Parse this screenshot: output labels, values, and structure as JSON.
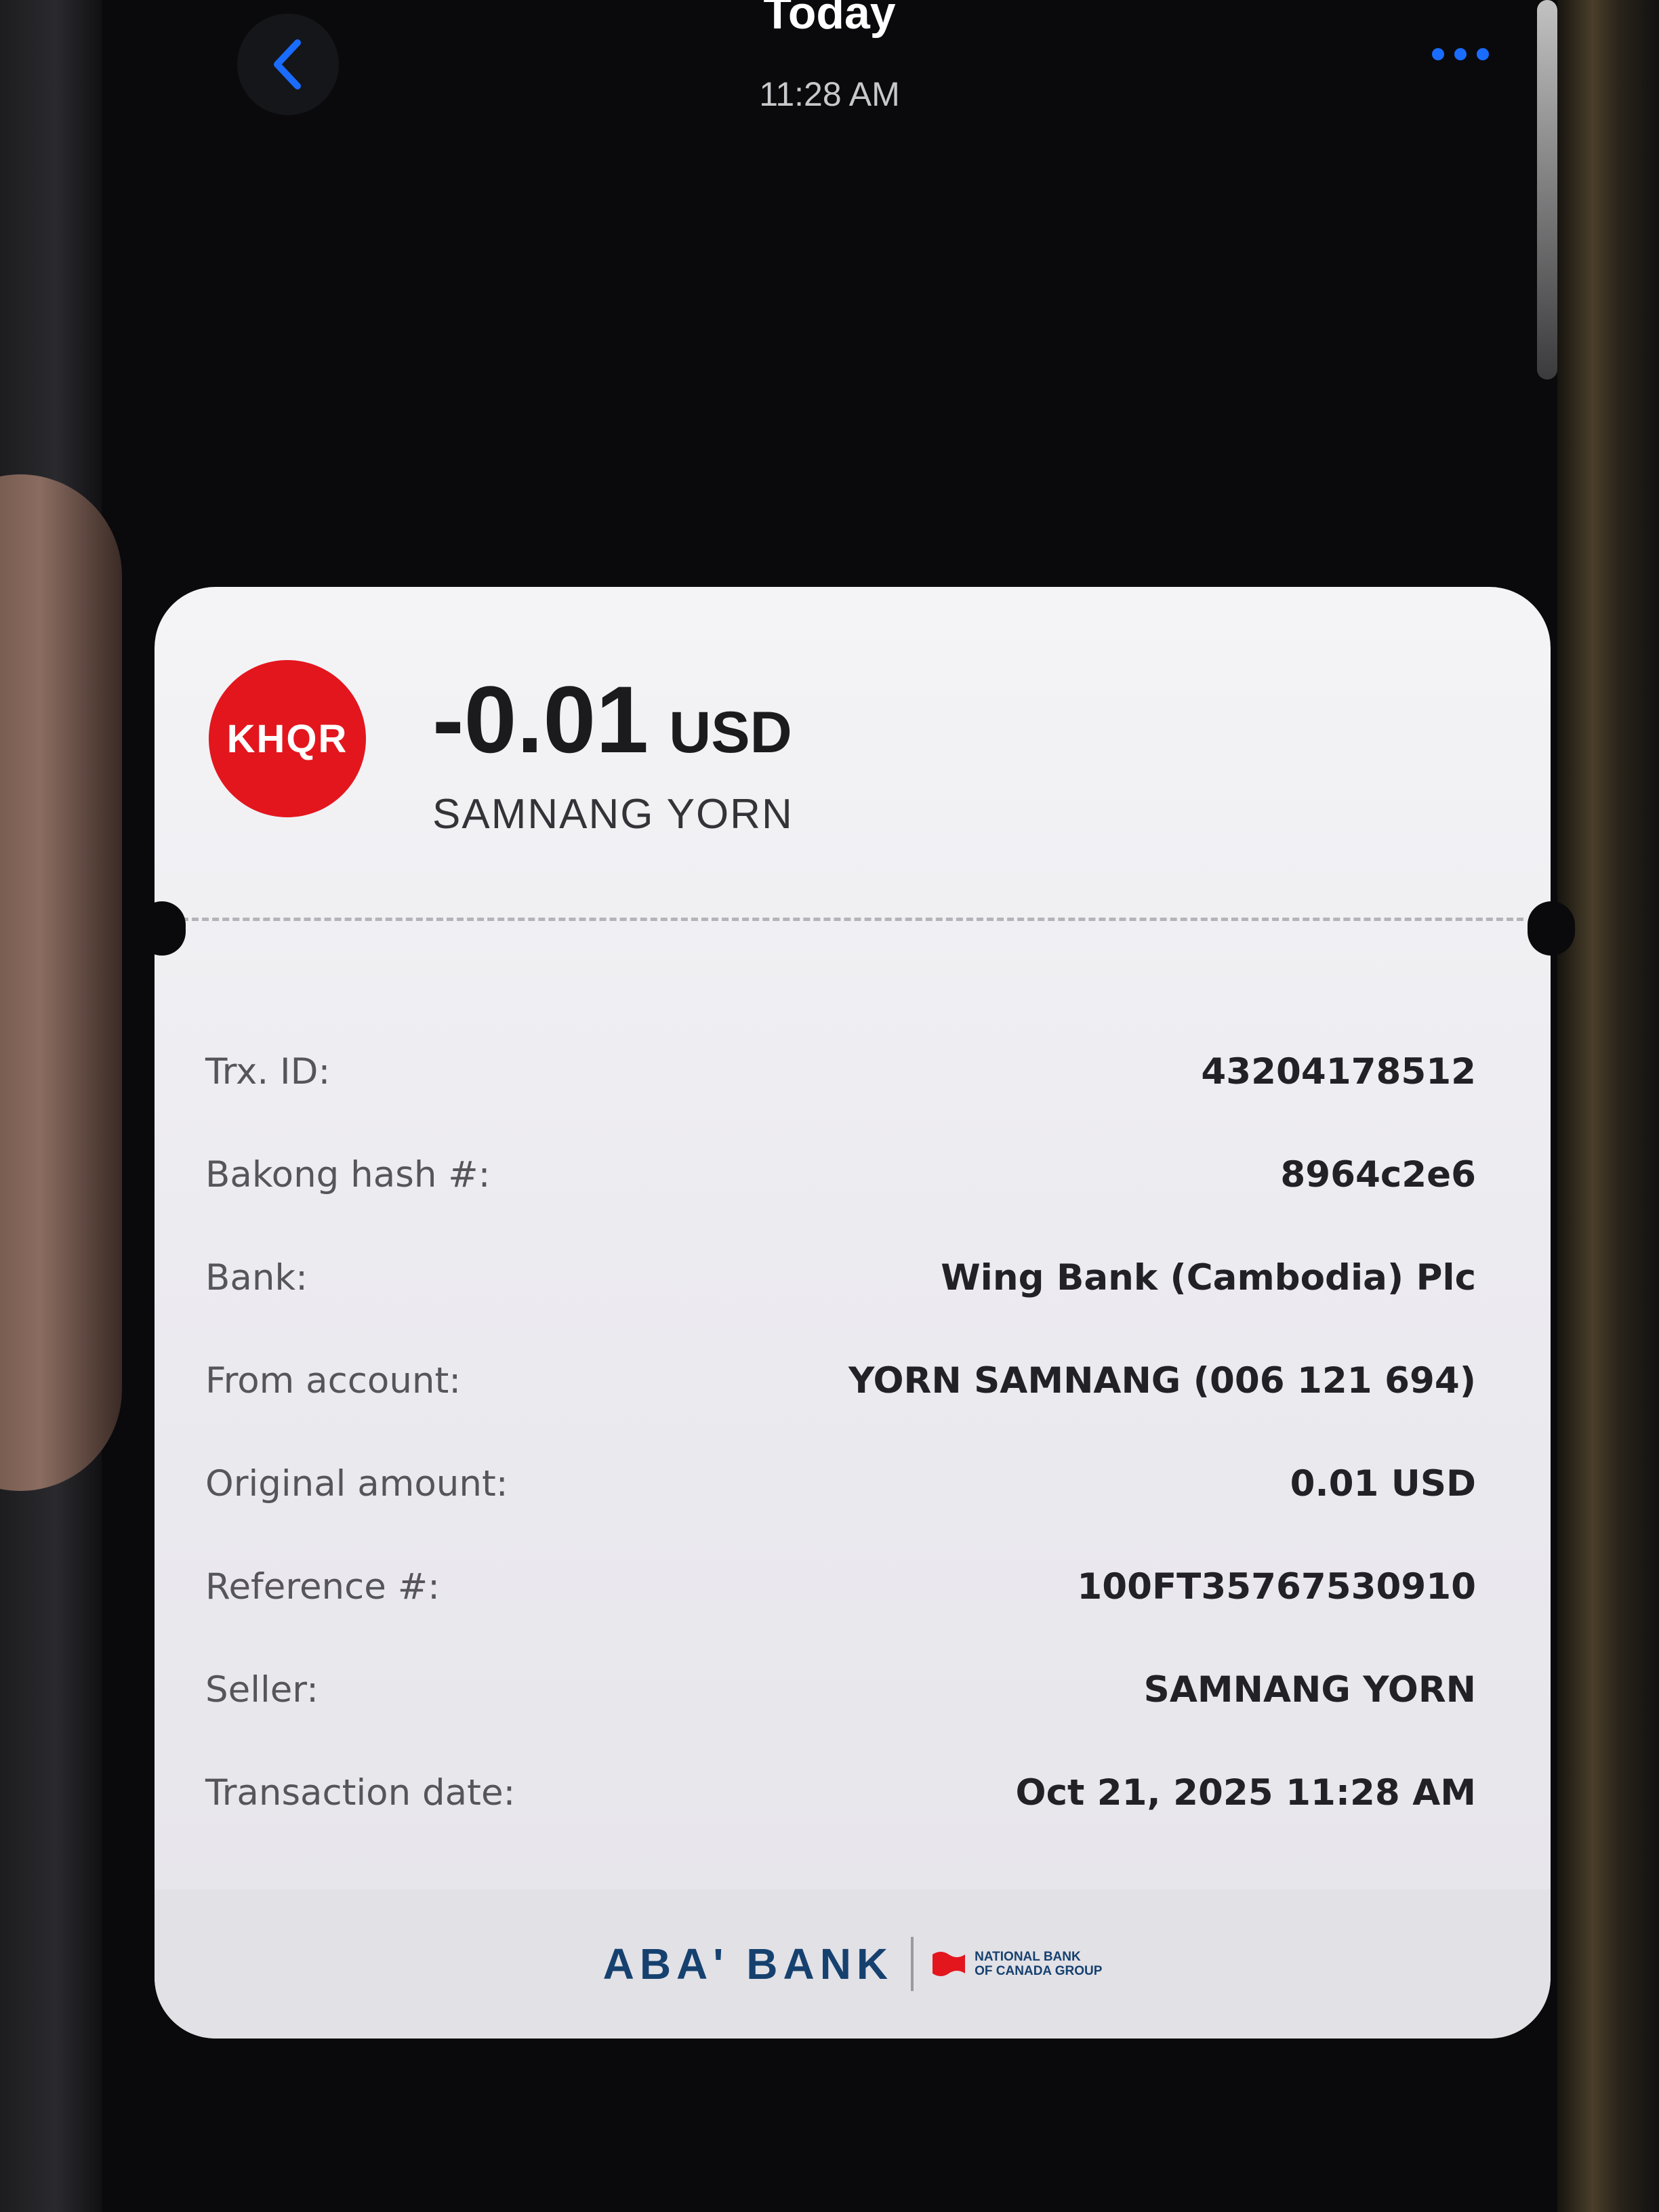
{
  "header": {
    "title": "Today",
    "time": "11:28 AM"
  },
  "transaction": {
    "logo_text": "KHQR",
    "amount": "-0.01",
    "currency": "USD",
    "recipient": "SAMNANG YORN"
  },
  "details": [
    {
      "label": "Trx. ID:",
      "value": "43204178512"
    },
    {
      "label": "Bakong hash #:",
      "value": "8964c2e6"
    },
    {
      "label": "Bank:",
      "value": "Wing Bank (Cambodia) Plc"
    },
    {
      "label": "From account:",
      "value": "YORN SAMNANG (006 121 694)"
    },
    {
      "label": "Original amount:",
      "value": "0.01 USD"
    },
    {
      "label": "Reference #:",
      "value": "100FT35767530910"
    },
    {
      "label": "Seller:",
      "value": "SAMNANG YORN"
    },
    {
      "label": "Transaction date:",
      "value": "Oct 21, 2025 11:28 AM"
    }
  ],
  "footer": {
    "brand": "ABA' BANK",
    "group_line1": "NATIONAL BANK",
    "group_line2": "OF CANADA GROUP"
  },
  "icons": {
    "back": "chevron-left-icon",
    "more": "more-horizontal-icon",
    "flag": "flag-icon"
  },
  "colors": {
    "accent_blue": "#1a6cff",
    "khqr_red": "#e3161e",
    "aba_navy": "#16416f",
    "flag_red": "#e3161e"
  }
}
